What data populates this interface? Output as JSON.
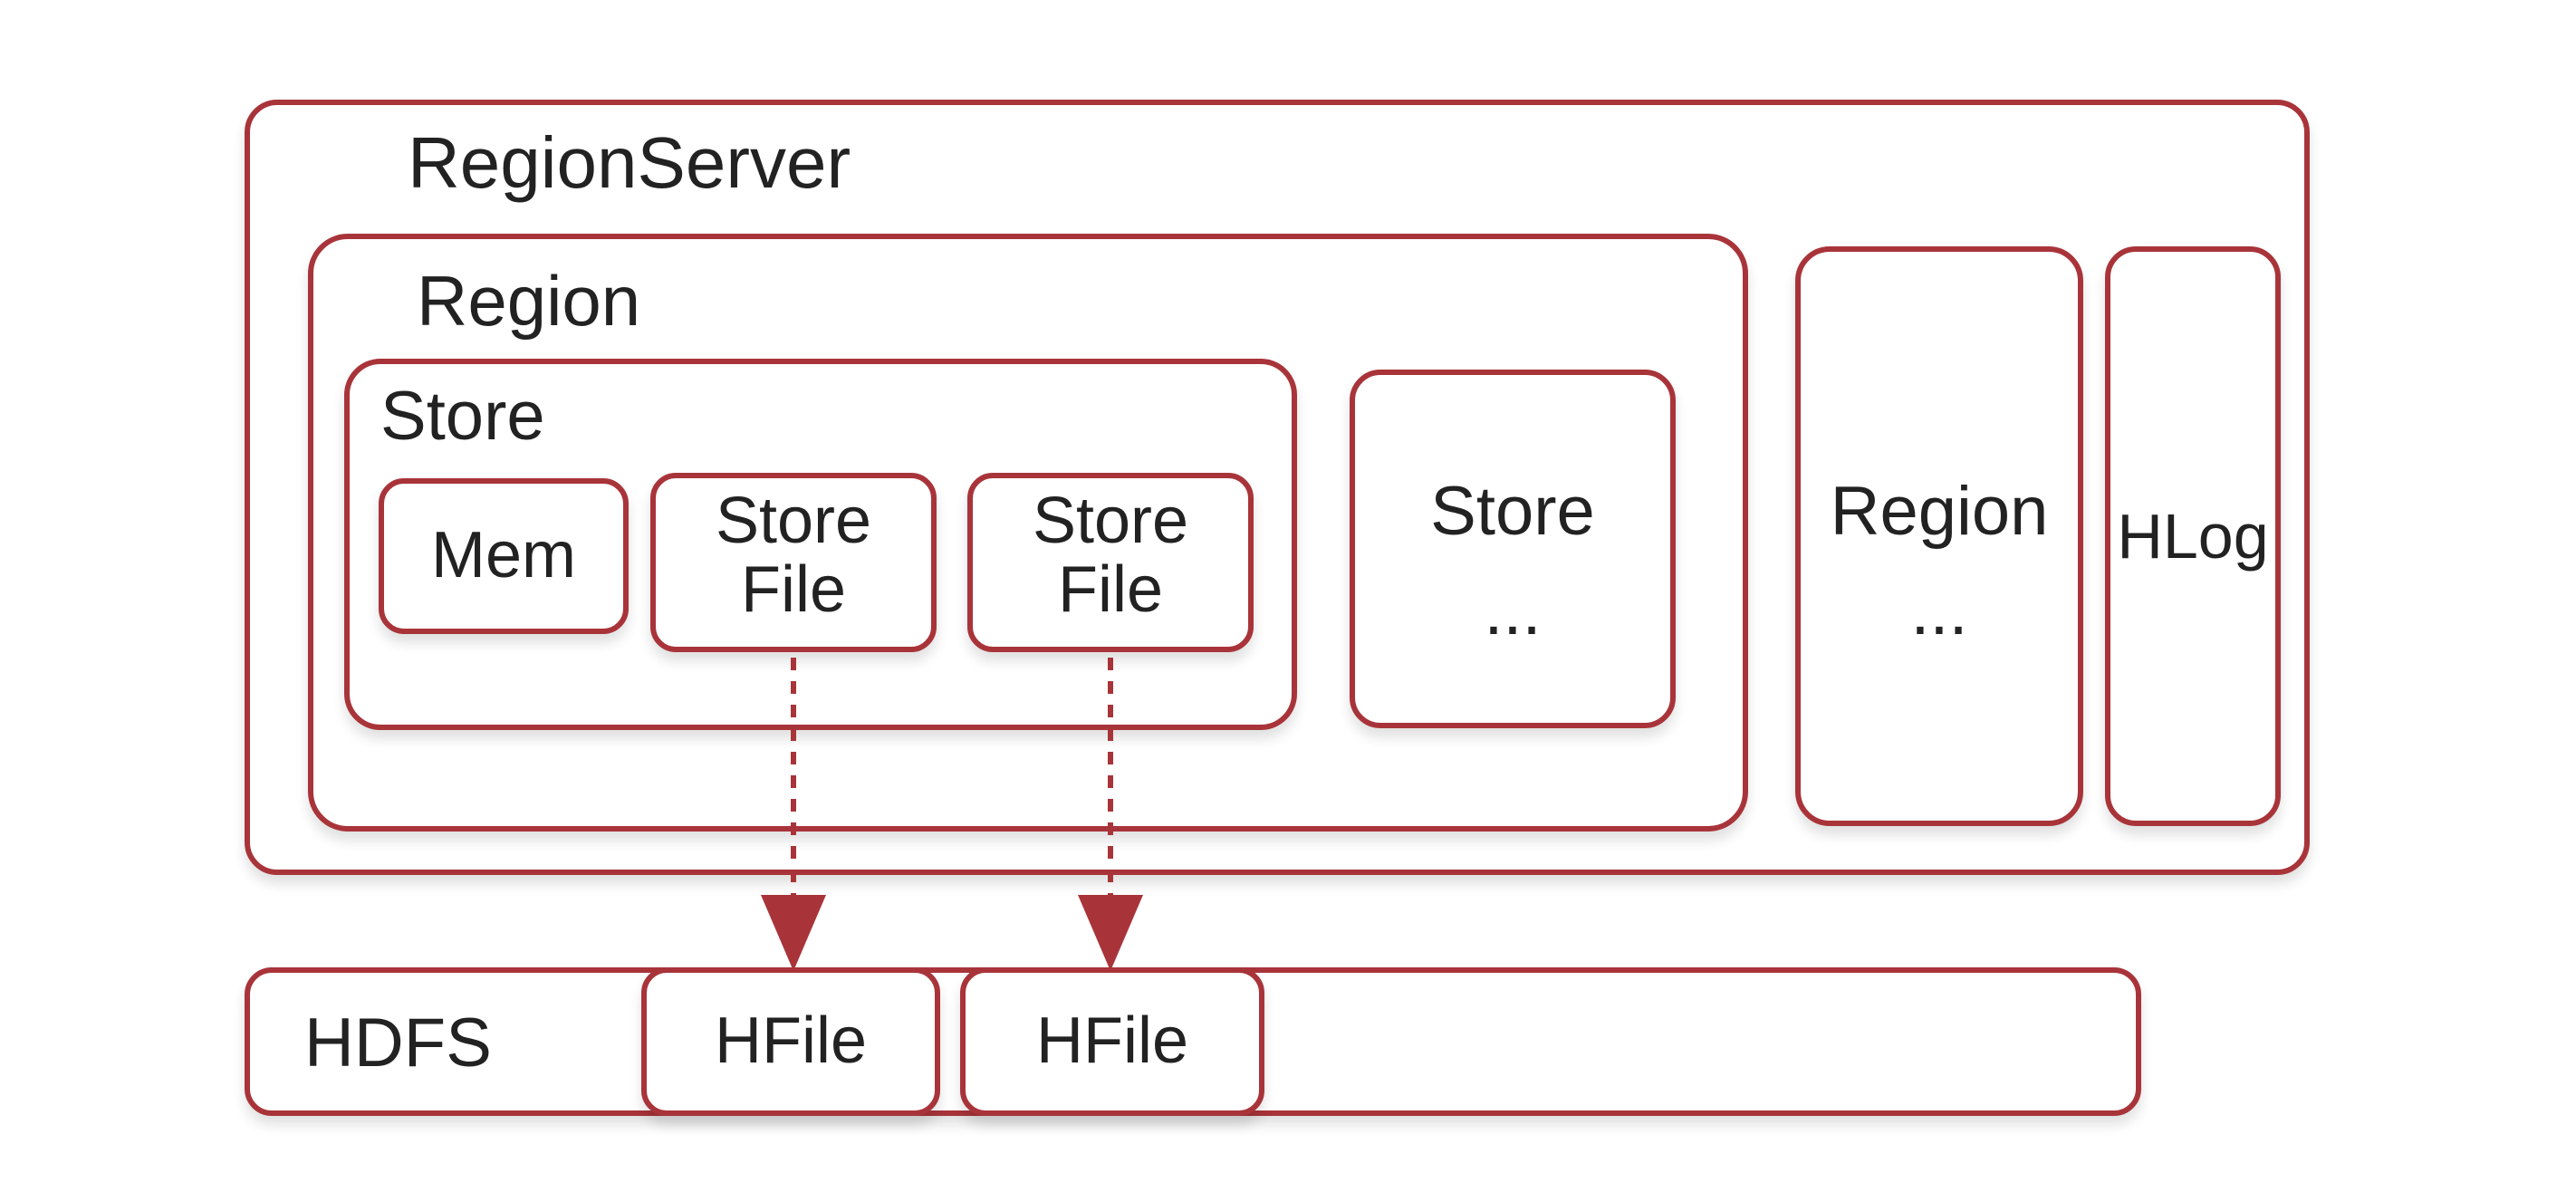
{
  "regionServer": {
    "title": "RegionServer"
  },
  "region": {
    "title": "Region"
  },
  "store": {
    "title": "Store"
  },
  "mem": {
    "label": "Mem"
  },
  "storeFile1": {
    "label": "Store\nFile"
  },
  "storeFile2": {
    "label": "Store\nFile"
  },
  "storeMore": {
    "label": "Store\n..."
  },
  "regionMore": {
    "label": "Region\n..."
  },
  "hlog": {
    "label": "HLog"
  },
  "hdfs": {
    "title": "HDFS"
  },
  "hfile1": {
    "label": "HFile"
  },
  "hfile2": {
    "label": "HFile"
  },
  "colors": {
    "border": "#a8343a",
    "text": "#222222",
    "bg": "#ffffff"
  }
}
